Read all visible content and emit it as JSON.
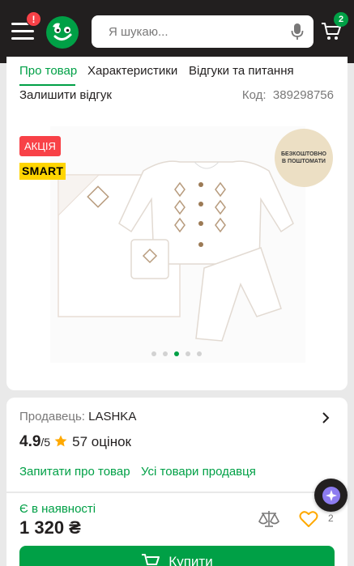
{
  "header": {
    "alert_badge": "!",
    "search_placeholder": "Я шукаю...",
    "cart_count": "2"
  },
  "tabs": [
    {
      "label": "Про товар",
      "active": true
    },
    {
      "label": "Характеристики",
      "active": false
    },
    {
      "label": "Відгуки та питання",
      "active": false
    }
  ],
  "product": {
    "leave_review": "Залишити відгук",
    "code_label": "Код:",
    "code_value": "389298756",
    "promo_badge": "АКЦІЯ",
    "smart_logo": "SMART",
    "free_shipping": "БЕЗКОШТОВНО В ПОШТОМАТИ",
    "gallery_active_index": 2,
    "gallery_count": 5
  },
  "seller": {
    "label": "Продавець:",
    "name": "LASHKA",
    "rating": "4.9",
    "rating_max": "/5",
    "rating_count": "57 оцінок",
    "ask_link": "Запитати про товар",
    "all_products_link": "Усі товари продавця"
  },
  "buy": {
    "availability": "Є в наявності",
    "price": "1 320 ₴",
    "wishlist_count": "2",
    "buy_label": "Купити"
  },
  "colors": {
    "brand_green": "#00a046",
    "header_dark": "#221f1f",
    "promo_red": "#f84147",
    "star": "#ffa900"
  },
  "icons": [
    "menu-icon",
    "rozetka-logo",
    "microphone-icon",
    "cart-icon",
    "chevron-right-icon",
    "star-icon",
    "compare-icon",
    "heart-icon",
    "assistant-icon"
  ]
}
